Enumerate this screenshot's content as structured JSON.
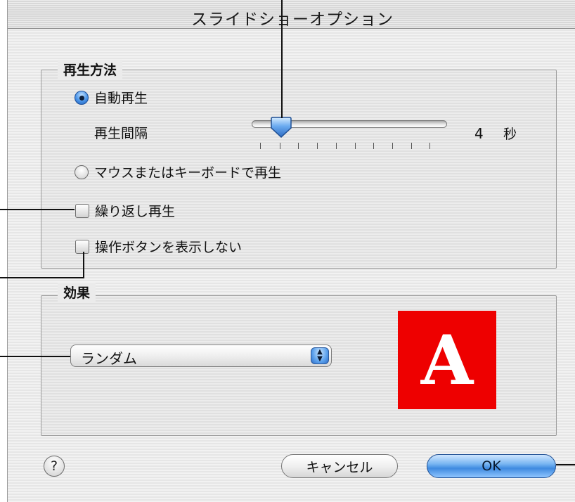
{
  "window": {
    "title": "スライドショーオプション"
  },
  "playback": {
    "group_label": "再生方法",
    "auto_play_label": "自動再生",
    "auto_play_selected": true,
    "interval_label": "再生間隔",
    "interval_value": "4",
    "interval_unit": "秒",
    "mouse_keyboard_label": "マウスまたはキーボードで再生",
    "mouse_keyboard_selected": false,
    "repeat_label": "繰り返し再生",
    "repeat_checked": false,
    "hide_buttons_label": "操作ボタンを表示しない",
    "hide_buttons_checked": false
  },
  "effects": {
    "group_label": "効果",
    "selected_effect": "ランダム",
    "preview_letter": "A",
    "preview_color": "#ee0000"
  },
  "footer": {
    "help_label": "?",
    "cancel_label": "キャンセル",
    "ok_label": "OK"
  }
}
